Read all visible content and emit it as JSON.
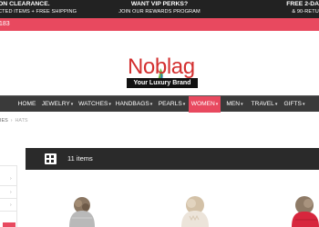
{
  "promo": {
    "left": {
      "line1": "ON CLEARANCE.",
      "line2": "CTED ITEMS + FREE SHIPPING"
    },
    "middle": {
      "line1": "WANT VIP PERKS?",
      "line2": "JOIN OUR REWARDS PROGRAM"
    },
    "right": {
      "line1": "FREE 2-DAY",
      "line2": "& 90-RETUR"
    }
  },
  "phone": {
    "text": "183"
  },
  "logo": {
    "wordmark": "Noblag",
    "tagline": "Your Luxury Brand",
    "icon": "flame-icon"
  },
  "nav": {
    "items": [
      {
        "label": "HOME"
      },
      {
        "label": "JEWELRY",
        "caret": "▾"
      },
      {
        "label": "WATCHES",
        "caret": "▾"
      },
      {
        "label": "HANDBAGS",
        "caret": "▾"
      },
      {
        "label": "PEARLS",
        "caret": "▾"
      },
      {
        "label": "WOMEN",
        "caret": "▾"
      },
      {
        "label": "MEN",
        "caret": "▾"
      },
      {
        "label": "TRAVEL",
        "caret": "▾"
      },
      {
        "label": "GIFTS",
        "caret": "▾"
      }
    ],
    "active": "WOMEN"
  },
  "breadcrumb": {
    "parent": "IES",
    "separator": "›",
    "current": "HATS"
  },
  "toolbar": {
    "view_icon": "grid-icon",
    "count_label": "11 items"
  },
  "colors": {
    "accent": "#e8495f",
    "dark": "#222222",
    "nav": "#3a3a3a",
    "brand_red": "#d32f2f"
  }
}
